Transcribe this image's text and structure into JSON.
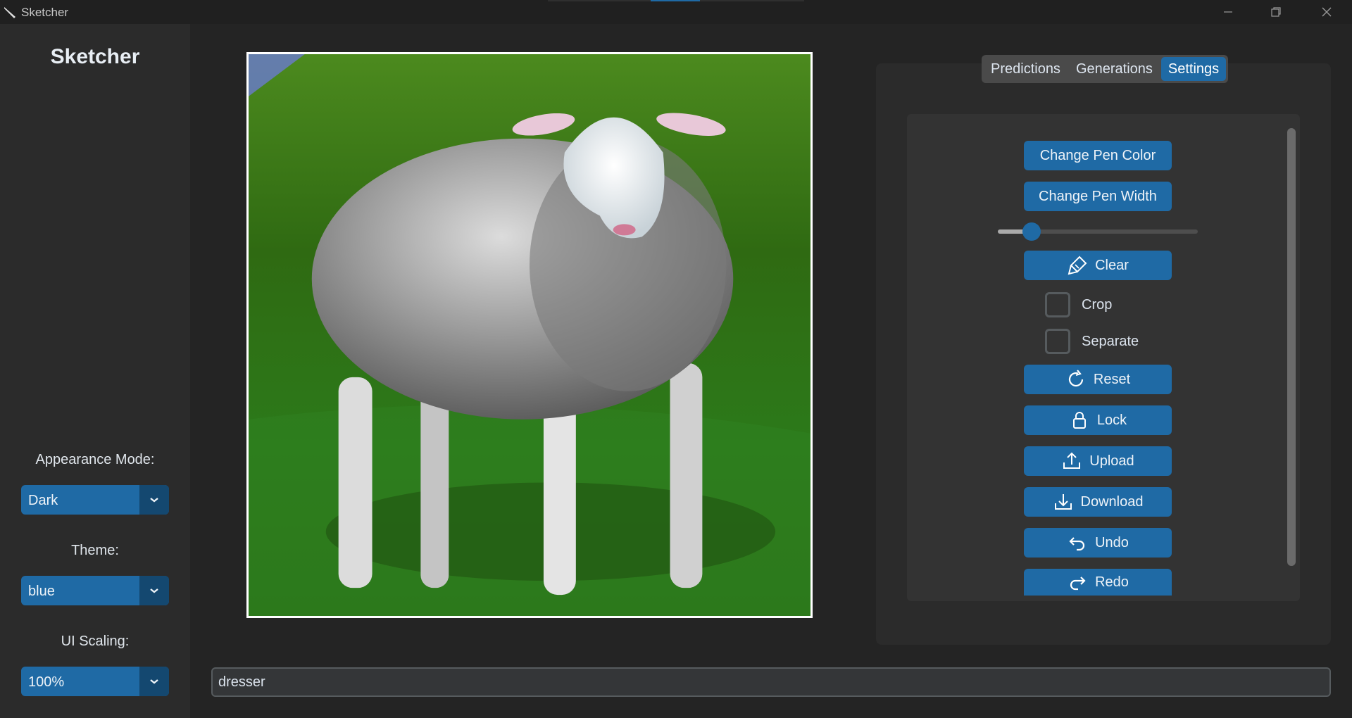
{
  "window": {
    "title": "Sketcher",
    "minimize_icon": "minimize-icon",
    "restore_icon": "restore-icon",
    "close_icon": "close-icon"
  },
  "sidebar": {
    "title": "Sketcher",
    "appearance_label": "Appearance Mode:",
    "appearance_value": "Dark",
    "theme_label": "Theme:",
    "theme_value": "blue",
    "scaling_label": "UI Scaling:",
    "scaling_value": "100%"
  },
  "tabs": [
    {
      "label": "Predictions",
      "active": false
    },
    {
      "label": "Generations",
      "active": false
    },
    {
      "label": "Settings",
      "active": true
    }
  ],
  "settings": {
    "change_pen_color": "Change Pen Color",
    "change_pen_width": "Change Pen Width",
    "pen_width_fraction": 0.17,
    "clear": "Clear",
    "crop": "Crop",
    "crop_checked": false,
    "separate": "Separate",
    "separate_checked": false,
    "reset": "Reset",
    "lock": "Lock",
    "upload": "Upload",
    "download": "Download",
    "undo": "Undo",
    "redo": "Redo"
  },
  "prompt": {
    "value": "dresser"
  },
  "colors": {
    "accent": "#1f6aa5",
    "accent_dark": "#144870",
    "background": "#242424",
    "panel": "#2b2b2b"
  }
}
